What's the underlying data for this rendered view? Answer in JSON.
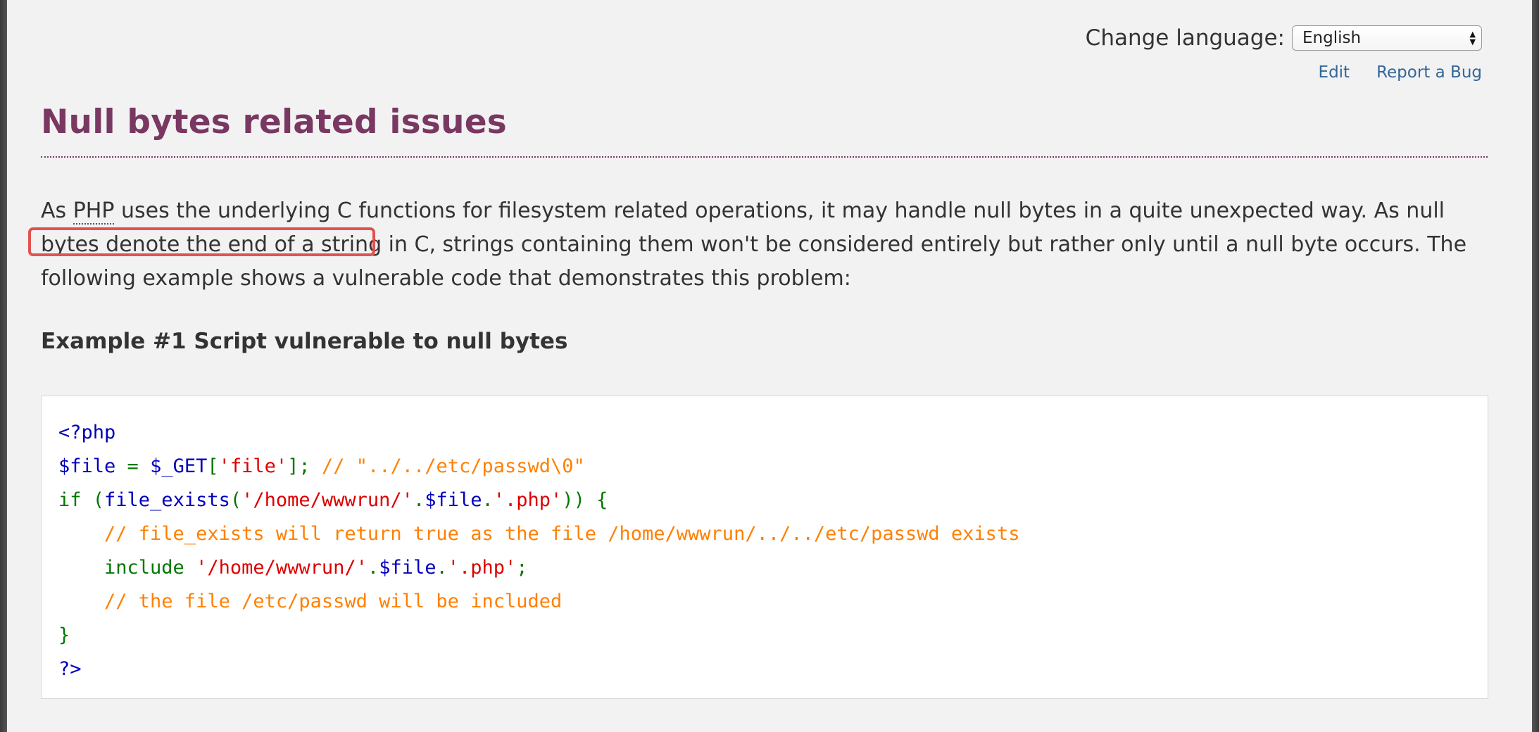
{
  "language_bar": {
    "label": "Change language:",
    "selected_language": "English"
  },
  "links": {
    "edit": "Edit",
    "report_bug": "Report a Bug"
  },
  "title": "Null bytes related issues",
  "paragraph": {
    "part1": "As ",
    "abbr": "PHP",
    "part2": " uses the underlying C functions for filesystem related operations, it may handle null bytes in a quite unexpected way. As null bytes denote the end of a string in C, strings containing them won't be considered entirely but rather only until a null byte occurs. The following example shows a vulnerable code that demonstrates this problem:"
  },
  "example": {
    "title": "Example #1 Script vulnerable to null bytes",
    "code": {
      "l1": "<?php",
      "l2_var": "$file ",
      "l2_eq": "= ",
      "l2_get": "$_GET",
      "l2_br1": "[",
      "l2_str": "'file'",
      "l2_br2": "]; ",
      "l2_comment": "// \"../../etc/passwd\\0\"",
      "l3_if": "if (",
      "l3_fn": "file_exists",
      "l3_p1": "(",
      "l3_str1": "'/home/wwwrun/'",
      "l3_dot1": ".",
      "l3_var": "$file",
      "l3_dot2": ".",
      "l3_str2": "'.php'",
      "l3_end": ")) {",
      "l4_comment": "    // file_exists will return true as the file /home/wwwrun/../../etc/passwd exists",
      "l5_include": "    include ",
      "l5_str1": "'/home/wwwrun/'",
      "l5_dot1": ".",
      "l5_var": "$file",
      "l5_dot2": ".",
      "l5_str2": "'.php'",
      "l5_semi": ";",
      "l6_comment": "    // the file /etc/passwd will be included",
      "l7": "}",
      "l8": "?>"
    }
  },
  "colors": {
    "title": "#793862",
    "link": "#336699",
    "highlight": "#e05350",
    "code_keyword": "#0000bb",
    "code_default": "#007700",
    "code_string": "#dd0000",
    "code_comment": "#ff8000"
  }
}
